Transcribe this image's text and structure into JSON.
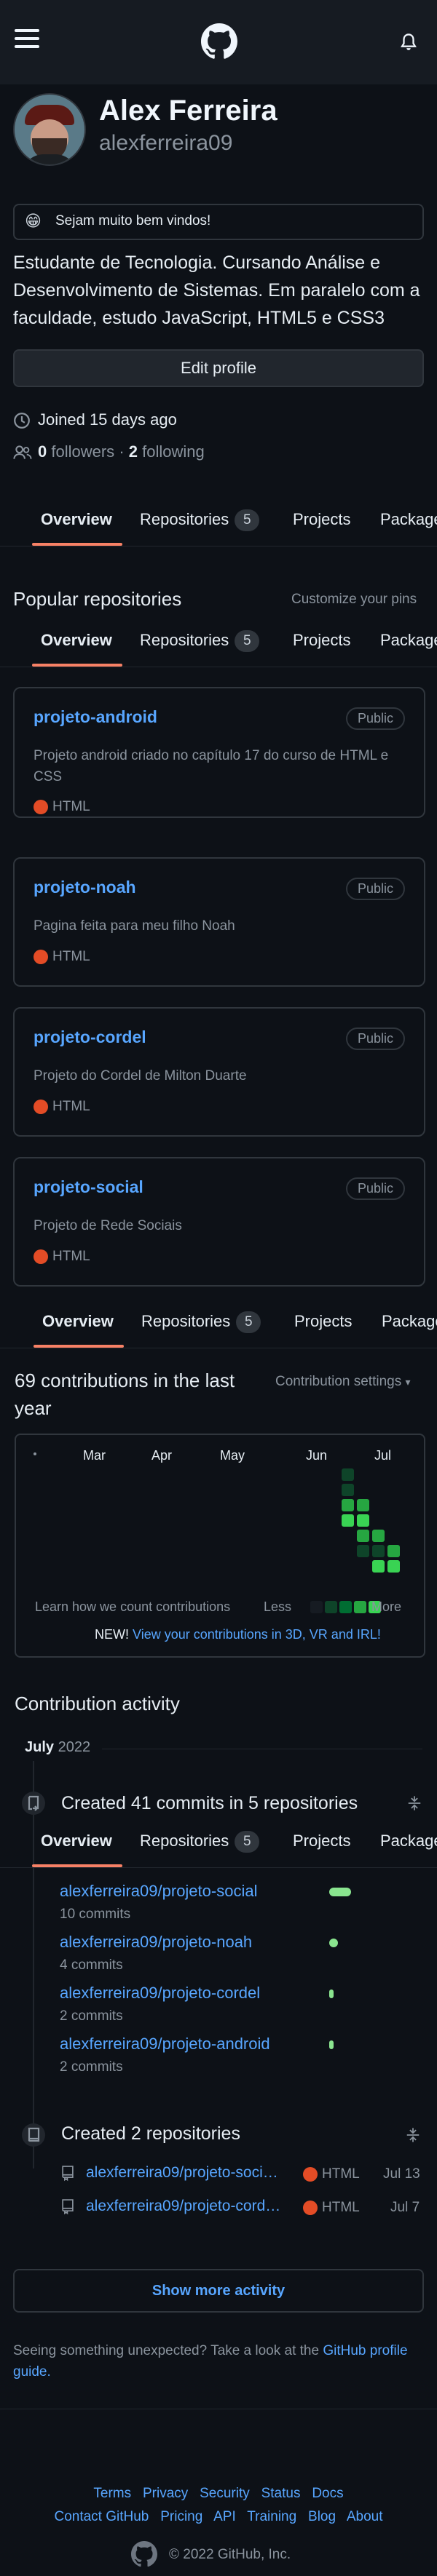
{
  "profile": {
    "name": "Alex Ferreira",
    "username": "alexferreira09",
    "status": "Sejam muito bem vindos!",
    "status_emoji": "😁",
    "bio": "Estudante de Tecnologia. Cursando Análise e Desenvolvimento de Sistemas. Em paralelo com a faculdade, estudo JavaScript, HTML5 e CSS3",
    "edit_button": "Edit profile",
    "joined": "Joined 15 days ago",
    "followers_count": "0",
    "followers_label": "followers",
    "following_count": "2",
    "following_label": "following",
    "separator": "·"
  },
  "tabs": {
    "overview": "Overview",
    "repositories": "Repositories",
    "repositories_count": "5",
    "projects": "Projects",
    "packages": "Packages"
  },
  "popular": {
    "title": "Popular repositories",
    "customize": "Customize your pins",
    "repos": [
      {
        "name": "projeto-android",
        "visibility": "Public",
        "description": "Projeto android criado no capítulo 17 do curso de HTML e CSS",
        "language": "HTML"
      },
      {
        "name": "projeto-noah",
        "visibility": "Public",
        "description": "Pagina feita para meu filho Noah",
        "language": "HTML"
      },
      {
        "name": "projeto-cordel",
        "visibility": "Public",
        "description": "Projeto do Cordel de Milton Duarte",
        "language": "HTML"
      },
      {
        "name": "projeto-social",
        "visibility": "Public",
        "description": "Projeto de Rede Sociais",
        "language": "HTML"
      }
    ],
    "language_color": "#e34c26"
  },
  "contributions": {
    "title": "69 contributions in the last year",
    "settings": "Contribution settings",
    "months": [
      "Mar",
      "Apr",
      "May",
      "Jun",
      "Jul"
    ],
    "learn": "Learn how we count contributions",
    "less": "Less",
    "more": "More",
    "new_label": "NEW!",
    "new_link": "View your contributions in 3D, VR and IRL!"
  },
  "activity": {
    "title": "Contribution activity",
    "month": "July",
    "year": "2022",
    "commits_title": "Created 41 commits in 5 repositories",
    "commits": [
      {
        "repo": "alexferreira09/projeto-social",
        "count": "10 commits",
        "share": 0.25
      },
      {
        "repo": "alexferreira09/projeto-noah",
        "count": "4 commits",
        "share": 0.1
      },
      {
        "repo": "alexferreira09/projeto-cordel",
        "count": "2 commits",
        "share": 0.05
      },
      {
        "repo": "alexferreira09/projeto-android",
        "count": "2 commits",
        "share": 0.05
      }
    ],
    "created_title": "Created 2 repositories",
    "created": [
      {
        "repo": "alexferreira09/projeto-soci…",
        "language": "HTML",
        "date": "Jul 13"
      },
      {
        "repo": "alexferreira09/projeto-cord…",
        "language": "HTML",
        "date": "Jul 7"
      }
    ],
    "show_more": "Show more activity",
    "unexpected": "Seeing something unexpected? Take a look at the",
    "guide_link": "GitHub profile guide."
  },
  "footer": {
    "row1": [
      "Terms",
      "Privacy",
      "Security",
      "Status",
      "Docs"
    ],
    "row2": [
      "Contact GitHub",
      "Pricing",
      "API",
      "Training",
      "Blog",
      "About"
    ],
    "copyright": "© 2022 GitHub, Inc."
  },
  "icons": {
    "menu": "hamburger-icon",
    "logo": "github-logo-icon",
    "notifications": "bell-icon",
    "joined": "clock-icon",
    "followers": "people-icon",
    "commits": "repo-push-icon",
    "repo": "repo-icon",
    "fold": "unfold-icon"
  },
  "colors": {
    "accent": "#58a6ff",
    "tab_underline": "#f78166",
    "green": "#39d353"
  }
}
